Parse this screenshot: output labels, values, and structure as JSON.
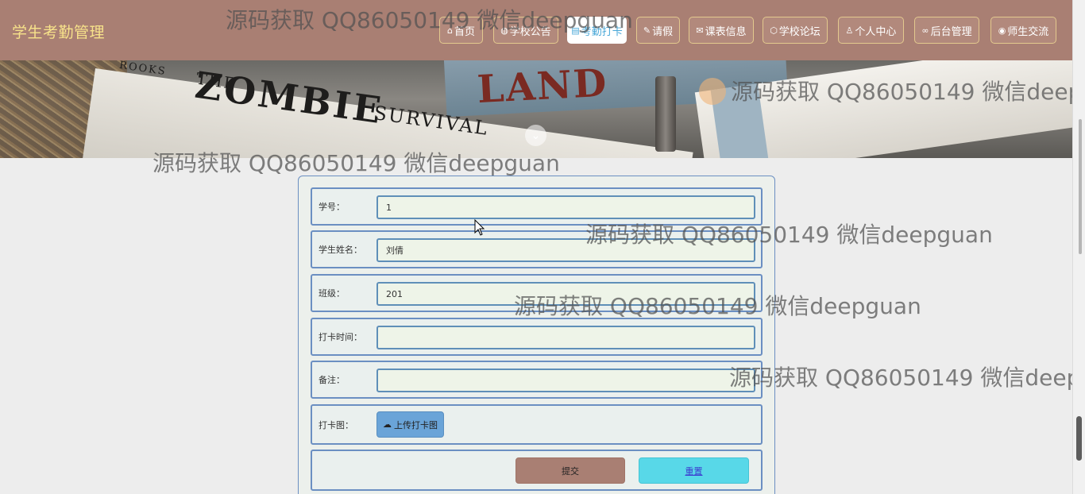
{
  "header": {
    "brand": "学生考勤管理",
    "nav": [
      {
        "icon": "⌂",
        "label": "首页"
      },
      {
        "icon": "◍",
        "label": "学校公告"
      },
      {
        "icon": "▤",
        "label": "考勤打卡"
      },
      {
        "icon": "✎",
        "label": "请假"
      },
      {
        "icon": "✉",
        "label": "课表信息"
      },
      {
        "icon": "⬡",
        "label": "学校论坛"
      },
      {
        "icon": "♙",
        "label": "个人中心"
      },
      {
        "icon": "∞",
        "label": "后台管理"
      },
      {
        "icon": "◉",
        "label": "师生交流"
      }
    ],
    "active_nav": "考勤打卡"
  },
  "banner": {
    "book_text_1": "ROOKS",
    "book_text_2": "THE",
    "book_text_3": "ZOMBIE",
    "book_text_4": "SURVIVAL",
    "book_text_5": "LAND",
    "down_icon": "⌄"
  },
  "form": {
    "fields": [
      {
        "label": "学号：",
        "value": "1"
      },
      {
        "label": "学生姓名：",
        "value": "刘倩"
      },
      {
        "label": "班级：",
        "value": "201"
      },
      {
        "label": "打卡时间：",
        "value": ""
      },
      {
        "label": "备注：",
        "value": ""
      }
    ],
    "upload": {
      "label": "打卡图：",
      "button": "上传打卡图",
      "icon": "☁"
    },
    "submit": "提交",
    "reset": "重置"
  },
  "watermark": {
    "text": "源码获取 QQ86050149 微信deepguan"
  },
  "colors": {
    "header_bg": "#a97f73",
    "brand": "#f7e28a",
    "submit_bg": "#a97f73",
    "reset_bg": "#58d8e8",
    "upload_bg": "#6aa4d8",
    "field_border": "#6b8fc2"
  }
}
